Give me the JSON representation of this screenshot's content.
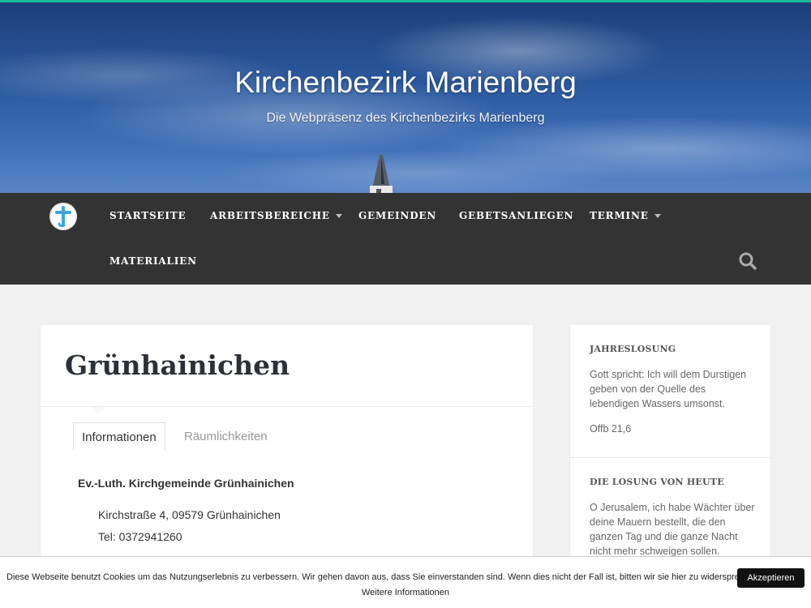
{
  "header": {
    "site_title": "Kirchenbezirk Marienberg",
    "tagline": "Die Webpräsenz des Kirchenbezirks Marienberg"
  },
  "nav": {
    "items": [
      {
        "label": "STARTSEITE",
        "dropdown": false
      },
      {
        "label": "ARBEITSBEREICHE",
        "dropdown": true
      },
      {
        "label": "GEMEINDEN",
        "dropdown": false
      },
      {
        "label": "GEBETSANLIEGEN",
        "dropdown": false
      },
      {
        "label": "TERMINE",
        "dropdown": true
      },
      {
        "label": "MATERIALIEN",
        "dropdown": false
      }
    ],
    "search_icon": "search-icon",
    "logo_icon": "cross-logo-icon"
  },
  "main": {
    "title": "Grünhainichen",
    "tabs": [
      {
        "label": "Informationen",
        "active": true
      },
      {
        "label": "Räumlichkeiten",
        "active": false
      }
    ],
    "org_name": "Ev.-Luth. Kirchgemeinde Grünhainichen",
    "address_lines": [
      "Kirchstraße 4, 09579 Grünhainichen",
      "Tel: 0372941260"
    ]
  },
  "sidebar": {
    "widgets": [
      {
        "title": "JAHRESLOSUNG",
        "text": "Gott spricht: Ich will dem Durstigen geben von der Quelle des lebendigen Wassers umsonst.",
        "reference": "Offb 21,6"
      },
      {
        "title": "DIE LOSUNG VON HEUTE",
        "text": "O Jerusalem, ich habe Wächter über deine Mauern bestellt, die den ganzen Tag und die ganze Nacht nicht mehr schweigen sollen."
      }
    ]
  },
  "cookie": {
    "message": "Diese Webseite benutzt Cookies um das Nutzungserlebnis zu verbessern. Wir gehen davon aus, dass Sie einverstanden sind. Wenn dies nicht der Fall ist, bitten wir sie hier zu widersprechen.",
    "accept_label": "Akzeptieren",
    "more_info_label": "Weitere Informationen"
  },
  "colors": {
    "accent": "#1abc9c",
    "navbar": "#333333",
    "background": "#f1f1f1"
  }
}
